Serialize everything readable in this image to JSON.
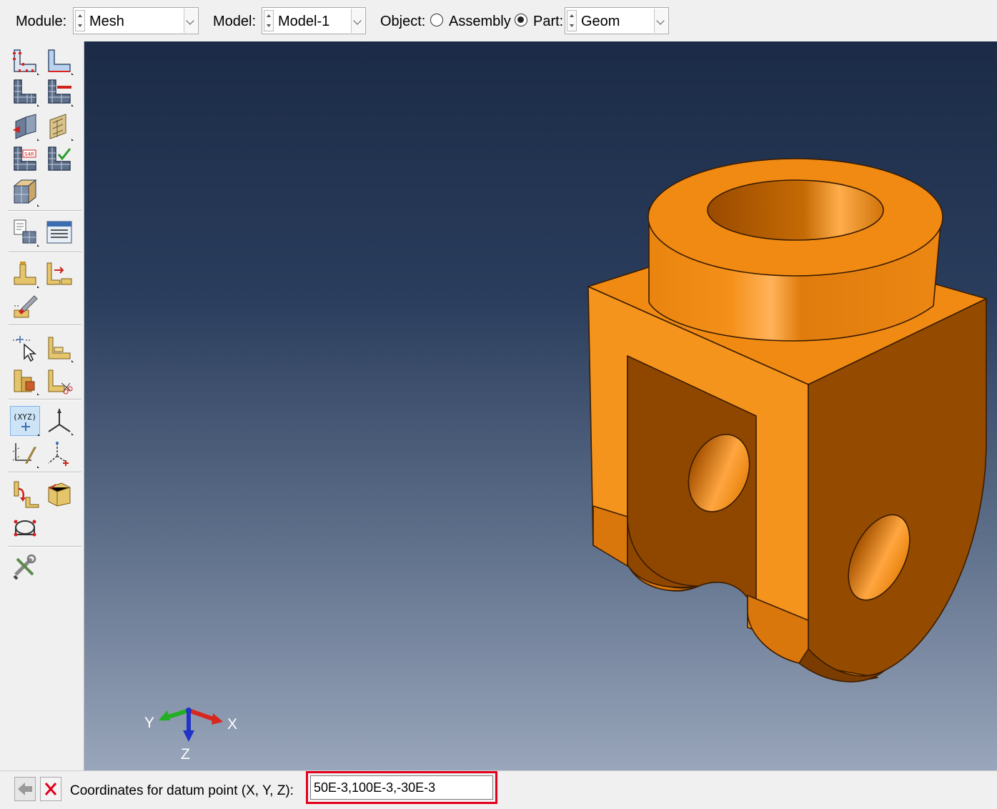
{
  "context_bar": {
    "module_label": "Module:",
    "module_value": "Mesh",
    "model_label": "Model:",
    "model_value": "Model-1",
    "object_label": "Object:",
    "assembly_label": "Assembly",
    "part_label": "Part:",
    "part_value": "Geom",
    "object_selected": "Part"
  },
  "toolbox": {
    "icons": [
      "seed-part-icon",
      "seed-edges-icon",
      "mesh-part-icon",
      "delete-mesh-icon",
      "assign-mesh-controls-icon",
      "assign-element-type-icon",
      "associate-mesh-icon",
      "verify-mesh-icon",
      "partition-cell-icon",
      "mesh-region-icon",
      "query-mesh-icon",
      "edit-mesh-icon",
      "create-feature-icon",
      "repair-icon",
      "delete-feature-icon",
      "query-icon",
      "datum-point-icon",
      "datum-axis-icon",
      "datum-plane-icon",
      "datum-csys-icon",
      "virtual-topology-icon",
      "partition-face-icon",
      "transform-icon",
      "mesh-tools-icon"
    ]
  },
  "viewport": {
    "triad": {
      "x_label": "X",
      "y_label": "Y",
      "z_label": "Z"
    },
    "part_color": "#f28a16",
    "background_top": "#1b2b47",
    "background_bottom": "#99a6bb"
  },
  "prompt": {
    "label": "Coordinates for datum point (X, Y, Z):",
    "value": "50E-3,100E-3,-30E-3",
    "highlight_color": "#e4001b"
  }
}
